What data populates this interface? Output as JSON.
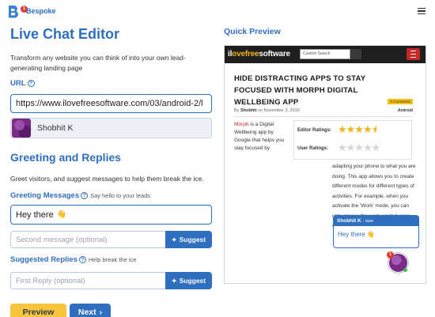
{
  "app": {
    "brand": "Bespoke",
    "logo_badge": "1"
  },
  "editor": {
    "title": "Live Chat Editor",
    "description": "Transform any website you can think of into your own lead-generating landing page",
    "url_label": "URL",
    "url_value": "https://www.ilovefreesoftware.com/03/android-2/l",
    "agent_name": "Shobhit K"
  },
  "greeting": {
    "section_title": "Greeting and Replies",
    "description": "Greet visitors, and suggest messages to help them break the ice.",
    "messages_label": "Greeting Messages",
    "messages_hint": "Say hello to your leads",
    "message1_value": "Hey there",
    "message1_emoji": "👋",
    "message2_placeholder": "Second message (optional)",
    "suggest_label": "Suggest",
    "replies_label": "Suggested Replies",
    "replies_hint": "Help break the ice",
    "reply1_placeholder": "First Reply (optional)"
  },
  "actions": {
    "preview_label": "Preview",
    "next_label": "Next",
    "next_icon": "›"
  },
  "quick_preview": {
    "title": "Quick Preview",
    "site": {
      "logo_part1": "il",
      "logo_part2": "ove",
      "logo_part3": "free",
      "logo_part4": "software",
      "search_placeholder": "Custom Search",
      "article_title": "HIDE DISTRACTING APPS TO STAY FOCUSED WITH MORPH DIGITAL WELLBEING APP",
      "comments": "0 Comments",
      "byline_prefix": "By",
      "author": "Shobhit",
      "byline_date": "on November 3, 2019",
      "category": "Android",
      "para1_red": "Morph",
      "para1_rest": " is a Digital Wellbeing app by Google that helps you stay focused by",
      "editor_ratings_label": "Editor Ratings:",
      "user_ratings_label": "User Ratings:",
      "editor_stars": 4.5,
      "user_stars": 0,
      "para2": "adapting your phone to what you are doing. This app allows you to create different modes for different types of activities. For example, when you activate the 'Work' mode, you can only access the work-related apps and won't get a distraction"
    },
    "chat": {
      "agent": "Shobhit K",
      "time": "now",
      "message": "Hey there",
      "emoji": "👋",
      "badge": "1"
    }
  },
  "colors": {
    "primary": "#2f6fbf",
    "preview_button": "#f6c53b",
    "badge": "#e53935",
    "online": "#33c24d"
  }
}
